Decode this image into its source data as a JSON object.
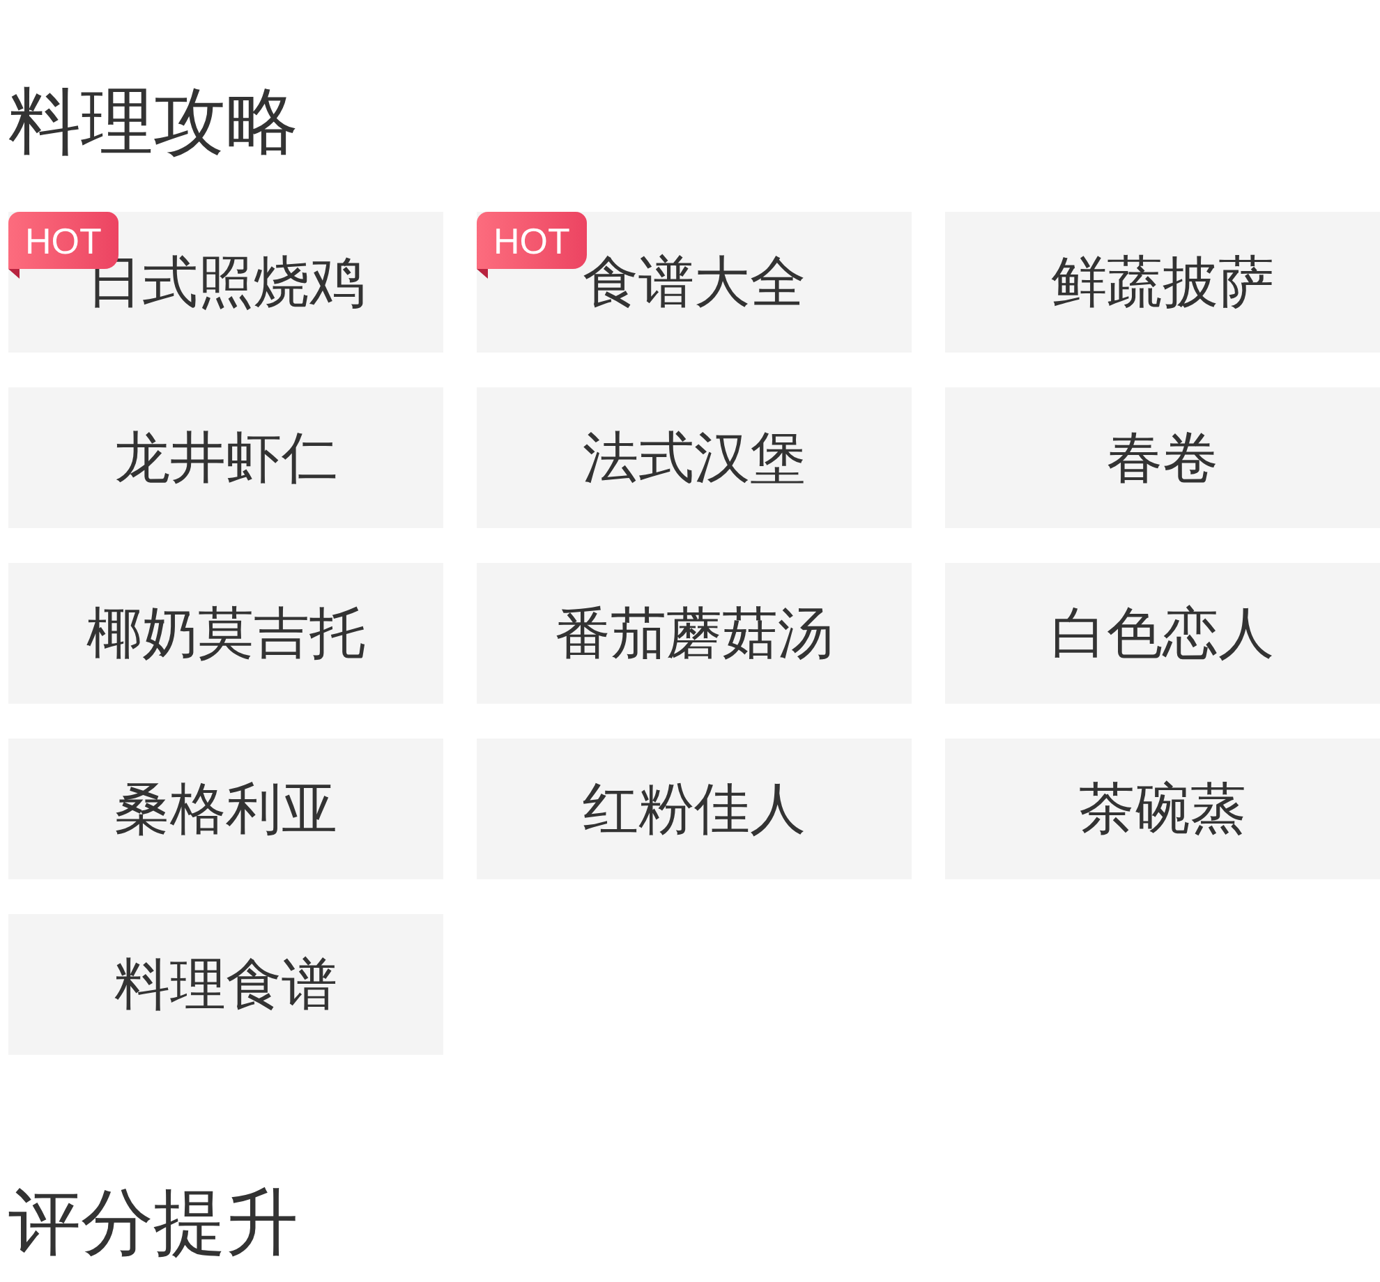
{
  "sections": [
    {
      "title": "料理攻略",
      "items": [
        {
          "label": "日式照烧鸡",
          "badge": "HOT"
        },
        {
          "label": "食谱大全",
          "badge": "HOT"
        },
        {
          "label": "鲜蔬披萨"
        },
        {
          "label": "龙井虾仁"
        },
        {
          "label": "法式汉堡"
        },
        {
          "label": "春卷"
        },
        {
          "label": "椰奶莫吉托"
        },
        {
          "label": "番茄蘑菇汤"
        },
        {
          "label": "白色恋人"
        },
        {
          "label": "桑格利亚"
        },
        {
          "label": "红粉佳人"
        },
        {
          "label": "茶碗蒸"
        },
        {
          "label": "料理食谱"
        }
      ]
    },
    {
      "title": "评分提升"
    }
  ]
}
